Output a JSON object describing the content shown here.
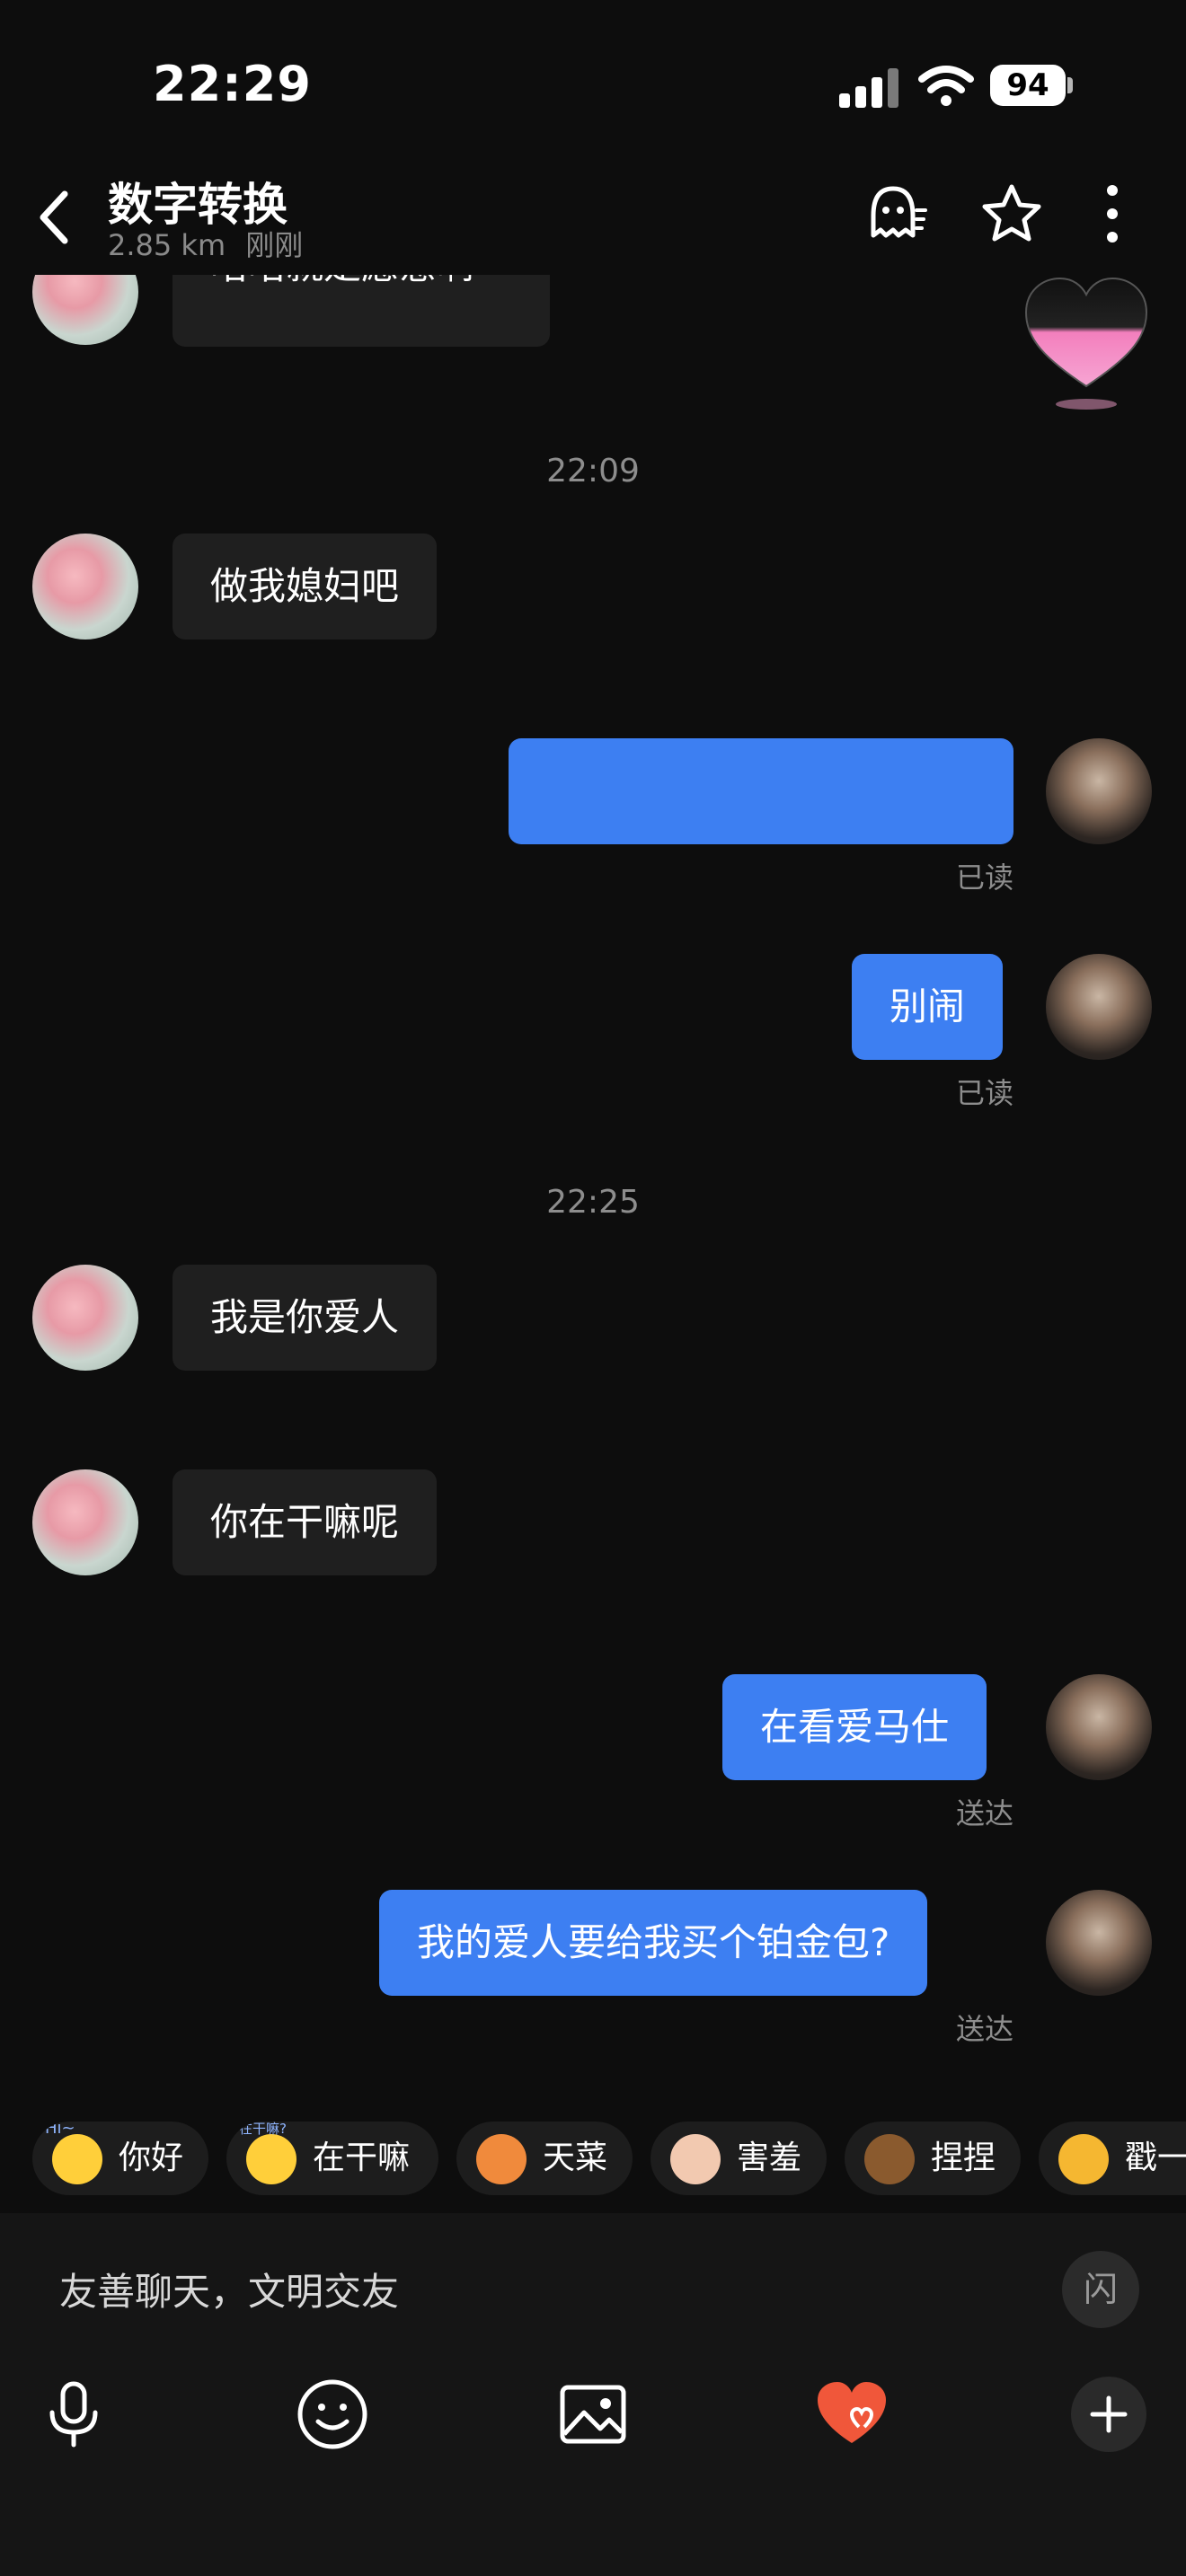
{
  "status_bar": {
    "time": "22:29",
    "battery": "94"
  },
  "header": {
    "title": "数字转换",
    "distance": "2.85 km",
    "presence": "刚刚"
  },
  "messages": {
    "partial_top": "唔唔就是愿意啊",
    "ts1": "22:09",
    "m1": "做我媳妇吧",
    "read1": "已读",
    "m3": "别闹",
    "read2": "已读",
    "ts2": "22:25",
    "m4": "我是你爱人",
    "m5": "你在干嘛呢",
    "m6": "在看爱马仕",
    "sent1": "送达",
    "m7": "我的爱人要给我买个铂金包?",
    "sent2": "送达"
  },
  "quick_replies": [
    {
      "label": "你好",
      "tag": "Hi~"
    },
    {
      "label": "在干嘛",
      "tag": "在干嘛?"
    },
    {
      "label": "天菜"
    },
    {
      "label": "害羞"
    },
    {
      "label": "捏捏"
    },
    {
      "label": "戳一"
    }
  ],
  "input": {
    "placeholder": "友善聊天，文明交友",
    "flash": "闪"
  },
  "colors": {
    "bubble_out": "#3d7ff2",
    "bubble_in": "#1f1f1f",
    "background": "#0d0d0d"
  }
}
